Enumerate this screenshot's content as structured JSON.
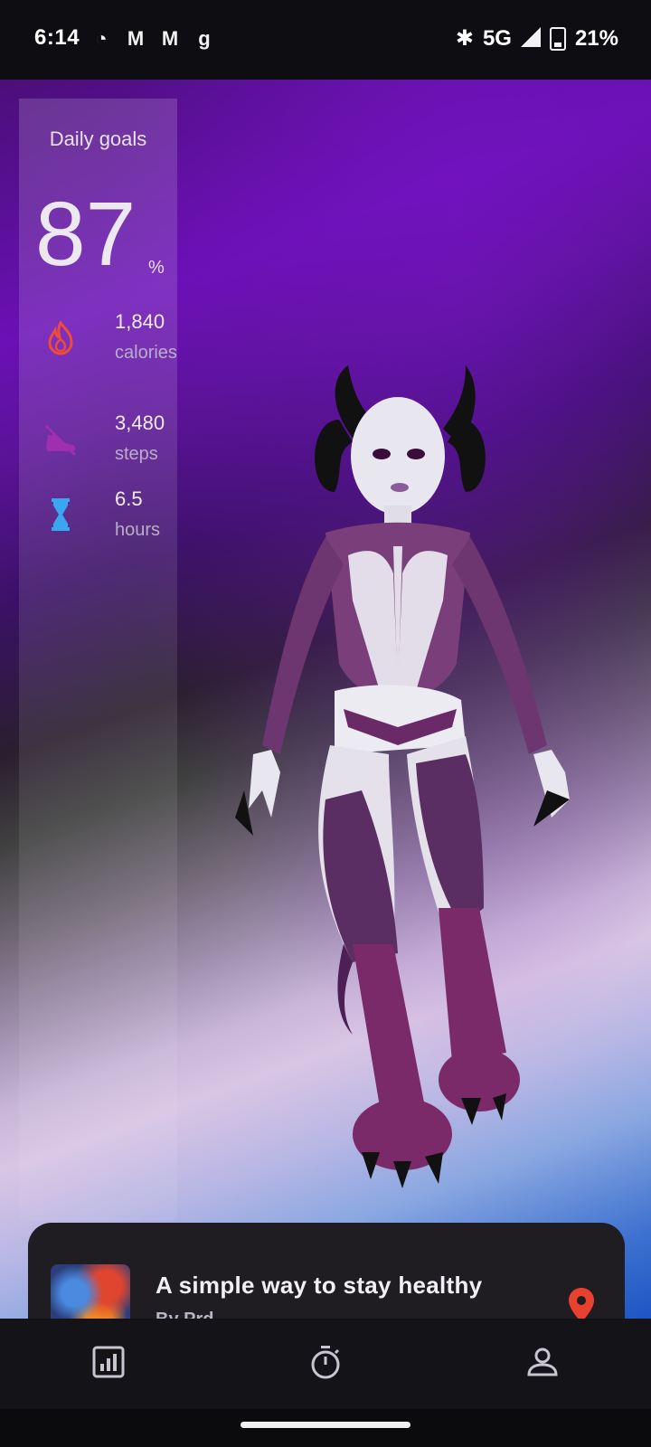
{
  "status_bar": {
    "time": "6:14",
    "left_icons": [
      "whatsapp-icon",
      "gmail-icon",
      "gmail-icon",
      "g-app-icon"
    ],
    "network": "5G",
    "battery": "21%"
  },
  "goals": {
    "title": "Daily goals",
    "percent": "87",
    "percent_sign": "%",
    "stats": [
      {
        "value": "1,840",
        "label": "calories",
        "icon": "flame-icon",
        "color": "#ef4a3a"
      },
      {
        "value": "3,480",
        "label": "steps",
        "icon": "shoe-icon",
        "color": "#9d2fb0"
      },
      {
        "value": "6.5",
        "label": "hours",
        "icon": "hourglass-icon",
        "color": "#3aa5f0"
      }
    ]
  },
  "card": {
    "title": "A simple way to stay healthy",
    "subtitle": "By Prd..."
  },
  "bottom_nav": {
    "items": [
      "stats-icon",
      "timer-icon",
      "profile-icon"
    ]
  }
}
